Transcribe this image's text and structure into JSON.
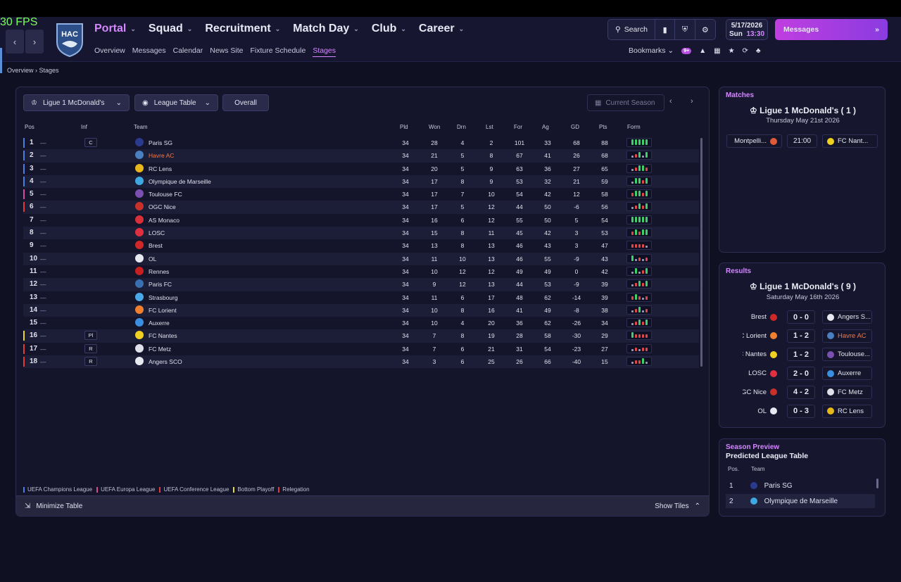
{
  "fps": "30 FPS",
  "club_crest": {
    "text": "HAC"
  },
  "nav": {
    "main": [
      {
        "label": "Portal",
        "active": true
      },
      {
        "label": "Squad",
        "active": false
      },
      {
        "label": "Recruitment",
        "active": false
      },
      {
        "label": "Match Day",
        "active": false
      },
      {
        "label": "Club",
        "active": false
      },
      {
        "label": "Career",
        "active": false
      }
    ],
    "sub": [
      {
        "label": "Overview",
        "active": false
      },
      {
        "label": "Messages",
        "active": false
      },
      {
        "label": "Calendar",
        "active": false
      },
      {
        "label": "News Site",
        "active": false
      },
      {
        "label": "Fixture Schedule",
        "active": false
      },
      {
        "label": "Stages",
        "active": true
      }
    ]
  },
  "toolbar": {
    "search_label": "Search",
    "bookmarks_label": "Bookmarks",
    "notif_badge": "9+"
  },
  "date": {
    "date": "5/17/2026",
    "day": "Sun",
    "time": "13:30"
  },
  "messages_label": "Messages",
  "breadcrumb": {
    "root": "Overview",
    "current": "Stages"
  },
  "filters": {
    "competition": "Ligue 1 McDonald's",
    "view": "League Table",
    "scope": "Overall",
    "season": "Current Season"
  },
  "table": {
    "headers": {
      "pos": "Pos",
      "inf": "Inf",
      "team": "Team",
      "pld": "Pld",
      "won": "Won",
      "drn": "Drn",
      "lst": "Lst",
      "for": "For",
      "ag": "Ag",
      "gd": "GD",
      "pts": "Pts",
      "form": "Form"
    },
    "rows": [
      {
        "pos": "1",
        "inf": "C",
        "team": "Paris SG",
        "pld": "34",
        "won": "28",
        "drn": "4",
        "lst": "2",
        "for": "101",
        "ag": "33",
        "gd": "68",
        "pts": "88",
        "zone": "ucl",
        "logo": "#2a3b8f",
        "form": "WWWWW",
        "highlight": false
      },
      {
        "pos": "2",
        "inf": "",
        "team": "Havre AC",
        "pld": "34",
        "won": "21",
        "drn": "5",
        "lst": "8",
        "for": "67",
        "ag": "41",
        "gd": "26",
        "pts": "68",
        "zone": "ucl",
        "logo": "#4a7fc0",
        "form": "DLWDW",
        "highlight": true
      },
      {
        "pos": "3",
        "inf": "",
        "team": "RC Lens",
        "pld": "34",
        "won": "20",
        "drn": "5",
        "lst": "9",
        "for": "63",
        "ag": "36",
        "gd": "27",
        "pts": "65",
        "zone": "ucl",
        "logo": "#e8b81a",
        "form": "DLWWL",
        "highlight": false
      },
      {
        "pos": "4",
        "inf": "",
        "team": "Olympique de Marseille",
        "pld": "34",
        "won": "17",
        "drn": "8",
        "lst": "9",
        "for": "53",
        "ag": "32",
        "gd": "21",
        "pts": "59",
        "zone": "ucl",
        "logo": "#3fa8e0",
        "form": "DWWLW",
        "highlight": false
      },
      {
        "pos": "5",
        "inf": "",
        "team": "Toulouse FC",
        "pld": "34",
        "won": "17",
        "drn": "7",
        "lst": "10",
        "for": "54",
        "ag": "42",
        "gd": "12",
        "pts": "58",
        "zone": "uel",
        "logo": "#7a4fb0",
        "form": "LWWLW",
        "highlight": false
      },
      {
        "pos": "6",
        "inf": "",
        "team": "OGC Nice",
        "pld": "34",
        "won": "17",
        "drn": "5",
        "lst": "12",
        "for": "44",
        "ag": "50",
        "gd": "-6",
        "pts": "56",
        "zone": "uecl",
        "logo": "#c8302a",
        "form": "DLWLW",
        "highlight": false
      },
      {
        "pos": "7",
        "inf": "",
        "team": "AS Monaco",
        "pld": "34",
        "won": "16",
        "drn": "6",
        "lst": "12",
        "for": "55",
        "ag": "50",
        "gd": "5",
        "pts": "54",
        "zone": "",
        "logo": "#d8303a",
        "form": "WWWWW",
        "highlight": false
      },
      {
        "pos": "8",
        "inf": "",
        "team": "LOSC",
        "pld": "34",
        "won": "15",
        "drn": "8",
        "lst": "11",
        "for": "45",
        "ag": "42",
        "gd": "3",
        "pts": "53",
        "zone": "",
        "logo": "#e03040",
        "form": "LWLWW",
        "highlight": false
      },
      {
        "pos": "9",
        "inf": "",
        "team": "Brest",
        "pld": "34",
        "won": "13",
        "drn": "8",
        "lst": "13",
        "for": "46",
        "ag": "43",
        "gd": "3",
        "pts": "47",
        "zone": "",
        "logo": "#d02828",
        "form": "LLLLD",
        "highlight": false
      },
      {
        "pos": "10",
        "inf": "",
        "team": "OL",
        "pld": "34",
        "won": "11",
        "drn": "10",
        "lst": "13",
        "for": "46",
        "ag": "55",
        "gd": "-9",
        "pts": "43",
        "zone": "",
        "logo": "#e8e8f0",
        "form": "WDLDL",
        "highlight": false
      },
      {
        "pos": "11",
        "inf": "",
        "team": "Rennes",
        "pld": "34",
        "won": "10",
        "drn": "12",
        "lst": "12",
        "for": "49",
        "ag": "49",
        "gd": "0",
        "pts": "42",
        "zone": "",
        "logo": "#c82020",
        "form": "DWDLW",
        "highlight": false
      },
      {
        "pos": "12",
        "inf": "",
        "team": "Paris FC",
        "pld": "34",
        "won": "9",
        "drn": "12",
        "lst": "13",
        "for": "44",
        "ag": "53",
        "gd": "-9",
        "pts": "39",
        "zone": "",
        "logo": "#3a6fb0",
        "form": "DLWLW",
        "highlight": false
      },
      {
        "pos": "13",
        "inf": "",
        "team": "Strasbourg",
        "pld": "34",
        "won": "11",
        "drn": "6",
        "lst": "17",
        "for": "48",
        "ag": "62",
        "gd": "-14",
        "pts": "39",
        "zone": "",
        "logo": "#4aa8e8",
        "form": "LWLDL",
        "highlight": false
      },
      {
        "pos": "14",
        "inf": "",
        "team": "FC Lorient",
        "pld": "34",
        "won": "10",
        "drn": "8",
        "lst": "16",
        "for": "41",
        "ag": "49",
        "gd": "-8",
        "pts": "38",
        "zone": "",
        "logo": "#f08030",
        "form": "DLWDL",
        "highlight": false
      },
      {
        "pos": "15",
        "inf": "",
        "team": "Auxerre",
        "pld": "34",
        "won": "10",
        "drn": "4",
        "lst": "20",
        "for": "36",
        "ag": "62",
        "gd": "-26",
        "pts": "34",
        "zone": "",
        "logo": "#3a8fe0",
        "form": "DLWLW",
        "highlight": false
      },
      {
        "pos": "16",
        "inf": "Pl",
        "team": "FC Nantes",
        "pld": "34",
        "won": "7",
        "drn": "8",
        "lst": "19",
        "for": "28",
        "ag": "58",
        "gd": "-30",
        "pts": "29",
        "zone": "playoff",
        "logo": "#f0d020",
        "form": "WLLLL",
        "highlight": false
      },
      {
        "pos": "17",
        "inf": "R",
        "team": "FC Metz",
        "pld": "34",
        "won": "7",
        "drn": "6",
        "lst": "21",
        "for": "31",
        "ag": "54",
        "gd": "-23",
        "pts": "27",
        "zone": "rel",
        "logo": "#e0e0ea",
        "form": "DLDLL",
        "highlight": false
      },
      {
        "pos": "18",
        "inf": "R",
        "team": "Angers SCO",
        "pld": "34",
        "won": "3",
        "drn": "6",
        "lst": "25",
        "for": "26",
        "ag": "66",
        "gd": "-40",
        "pts": "15",
        "zone": "rel",
        "logo": "#e8e8f0",
        "form": "DLLWD",
        "highlight": false
      }
    ]
  },
  "zones": {
    "ucl": "#4a7fe0",
    "uel": "#d84aa0",
    "uecl": "#e03a3a",
    "playoff": "#e8d830",
    "rel": "#e03a3a"
  },
  "legend": [
    {
      "label": "UEFA Champions League",
      "color": "#4a7fe0"
    },
    {
      "label": "UEFA Europa League",
      "color": "#d84aa0"
    },
    {
      "label": "UEFA Conference League",
      "color": "#e03a3a"
    },
    {
      "label": "Bottom Playoff",
      "color": "#e8d830"
    },
    {
      "label": "Relegation",
      "color": "#e03a3a"
    }
  ],
  "footer": {
    "minimize": "Minimize Table",
    "show_tiles": "Show Tiles"
  },
  "matches": {
    "title": "Matches",
    "competition": "Ligue 1 McDonald's",
    "round": "( 1 )",
    "date": "Thursday May 21st 2026",
    "fixture": {
      "home": "Montpelli...",
      "time": "21:00",
      "away": "FC Nant..."
    }
  },
  "results": {
    "title": "Results",
    "competition": "Ligue 1 McDonald's",
    "round": "( 9 )",
    "date": "Saturday May 16th 2026",
    "games": [
      {
        "home": "Brest",
        "score": "0 - 0",
        "away": "Angers S...",
        "home_logo": "#d02828",
        "away_logo": "#e8e8f0",
        "away_hl": false
      },
      {
        "home": "FC Lorient",
        "score": "1 - 2",
        "away": "Havre AC",
        "home_logo": "#f08030",
        "away_logo": "#4a7fc0",
        "away_hl": true
      },
      {
        "home": "FC Nantes",
        "score": "1 - 2",
        "away": "Toulouse...",
        "home_logo": "#f0d020",
        "away_logo": "#7a4fb0",
        "away_hl": false
      },
      {
        "home": "LOSC",
        "score": "2 - 0",
        "away": "Auxerre",
        "home_logo": "#e03040",
        "away_logo": "#3a8fe0",
        "away_hl": false
      },
      {
        "home": "OGC Nice",
        "score": "4 - 2",
        "away": "FC Metz",
        "home_logo": "#c8302a",
        "away_logo": "#e0e0ea",
        "away_hl": false
      },
      {
        "home": "OL",
        "score": "0 - 3",
        "away": "RC Lens",
        "home_logo": "#e8e8f0",
        "away_logo": "#e8b81a",
        "away_hl": false
      }
    ]
  },
  "preview": {
    "title": "Season Preview",
    "subtitle": "Predicted League Table",
    "headers": {
      "pos": "Pos.",
      "team": "Team"
    },
    "rows": [
      {
        "pos": "1",
        "team": "Paris SG",
        "logo": "#2a3b8f"
      },
      {
        "pos": "2",
        "team": "Olympique de Marseille",
        "logo": "#3fa8e0"
      }
    ]
  },
  "colors": {
    "accent": "#d487ff",
    "highlight": "#f07a4a",
    "win": "#3fd06a",
    "loss": "#e04848",
    "draw": "#9a9ab8"
  }
}
